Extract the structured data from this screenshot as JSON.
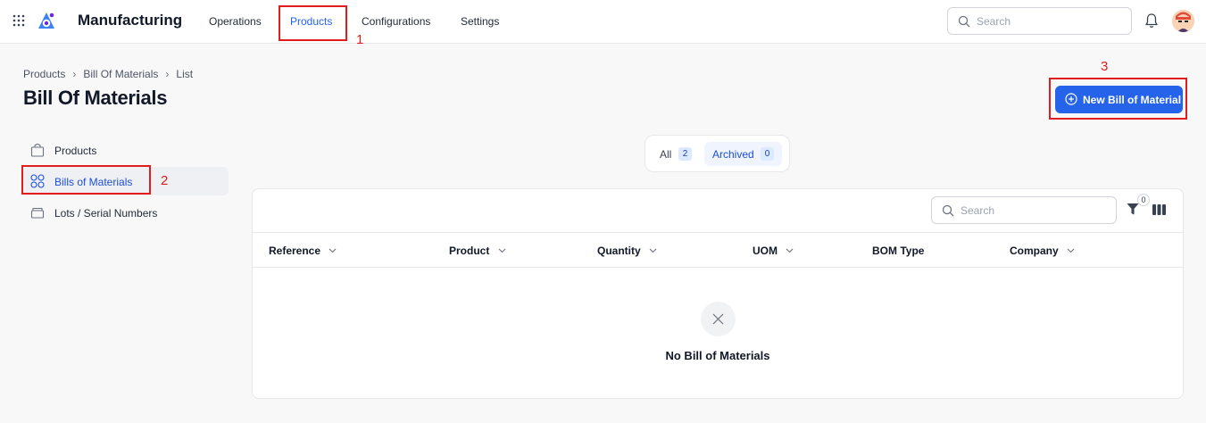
{
  "app": {
    "title": "Manufacturing",
    "brand_color": "#2563eb"
  },
  "topnav": {
    "items": [
      {
        "label": "Operations"
      },
      {
        "label": "Products",
        "active": true
      },
      {
        "label": "Configurations"
      },
      {
        "label": "Settings"
      }
    ],
    "search_placeholder": "Search"
  },
  "breadcrumb": [
    "Products",
    "Bill Of Materials",
    "List"
  ],
  "page": {
    "title": "Bill Of Materials",
    "new_button_label": "New Bill of Material"
  },
  "sidebar": {
    "items": [
      {
        "label": "Products",
        "icon": "bag-icon"
      },
      {
        "label": "Bills of Materials",
        "icon": "grid-circles-icon",
        "active": true
      },
      {
        "label": "Lots / Serial Numbers",
        "icon": "box-icon"
      }
    ]
  },
  "tabs": [
    {
      "label": "All",
      "count": "2"
    },
    {
      "label": "Archived",
      "count": "0",
      "active": true
    }
  ],
  "table": {
    "search_placeholder": "Search",
    "filter_count": "0",
    "columns": [
      "Reference",
      "Product",
      "Quantity",
      "UOM",
      "BOM Type",
      "Company"
    ],
    "empty_text": "No Bill of Materials"
  },
  "annotations": [
    "1",
    "2",
    "3"
  ]
}
